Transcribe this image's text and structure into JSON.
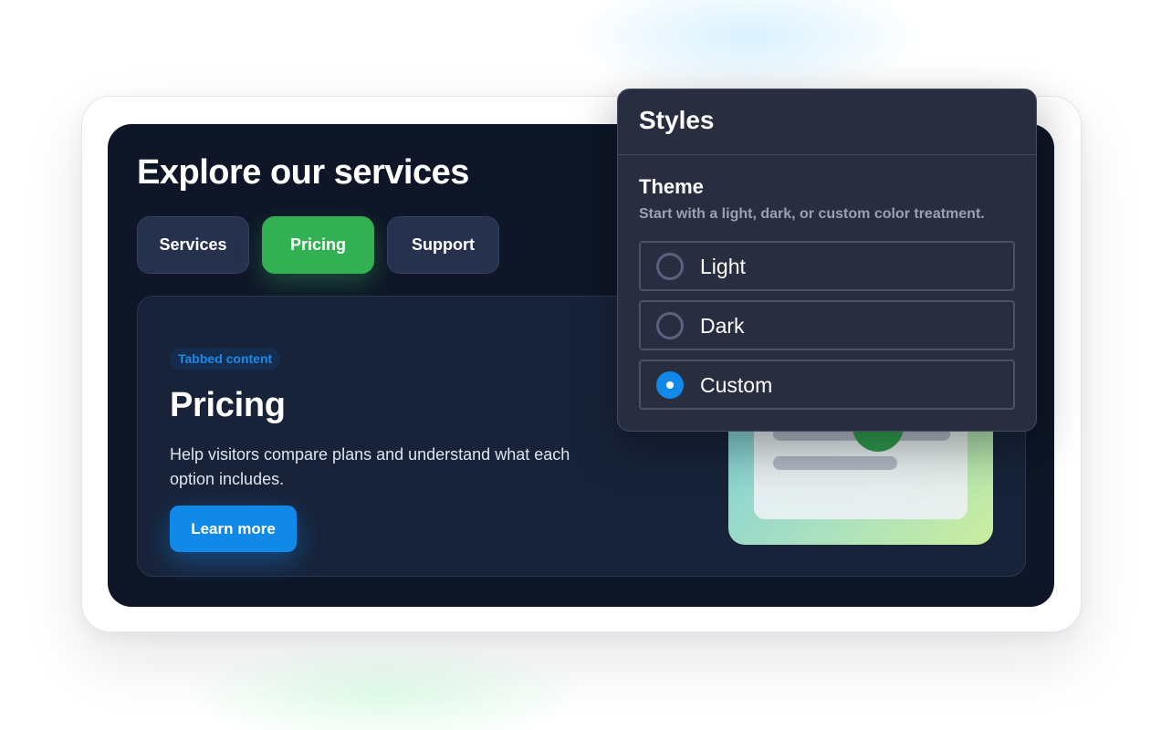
{
  "main": {
    "heading": "Explore our services",
    "tabs": [
      {
        "label": "Services",
        "active": false
      },
      {
        "label": "Pricing",
        "active": true
      },
      {
        "label": "Support",
        "active": false
      }
    ],
    "card": {
      "badge": "Tabbed content",
      "title": "Pricing",
      "description": "Help visitors compare plans and understand what each option includes.",
      "cta_label": "Learn more"
    }
  },
  "styles_popover": {
    "title": "Styles",
    "section_title": "Theme",
    "section_description": "Start with a light, dark, or custom color treatment.",
    "options": [
      {
        "label": "Light",
        "selected": false
      },
      {
        "label": "Dark",
        "selected": false
      },
      {
        "label": "Custom",
        "selected": true
      }
    ]
  },
  "colors": {
    "panel_background": "#0e1627",
    "active_tab": "#33b053",
    "primary_button": "#1189e8",
    "popover_background": "#282e40"
  },
  "icons": {
    "radio_unchecked": "radio-unchecked-icon",
    "radio_checked": "radio-checked-icon"
  }
}
